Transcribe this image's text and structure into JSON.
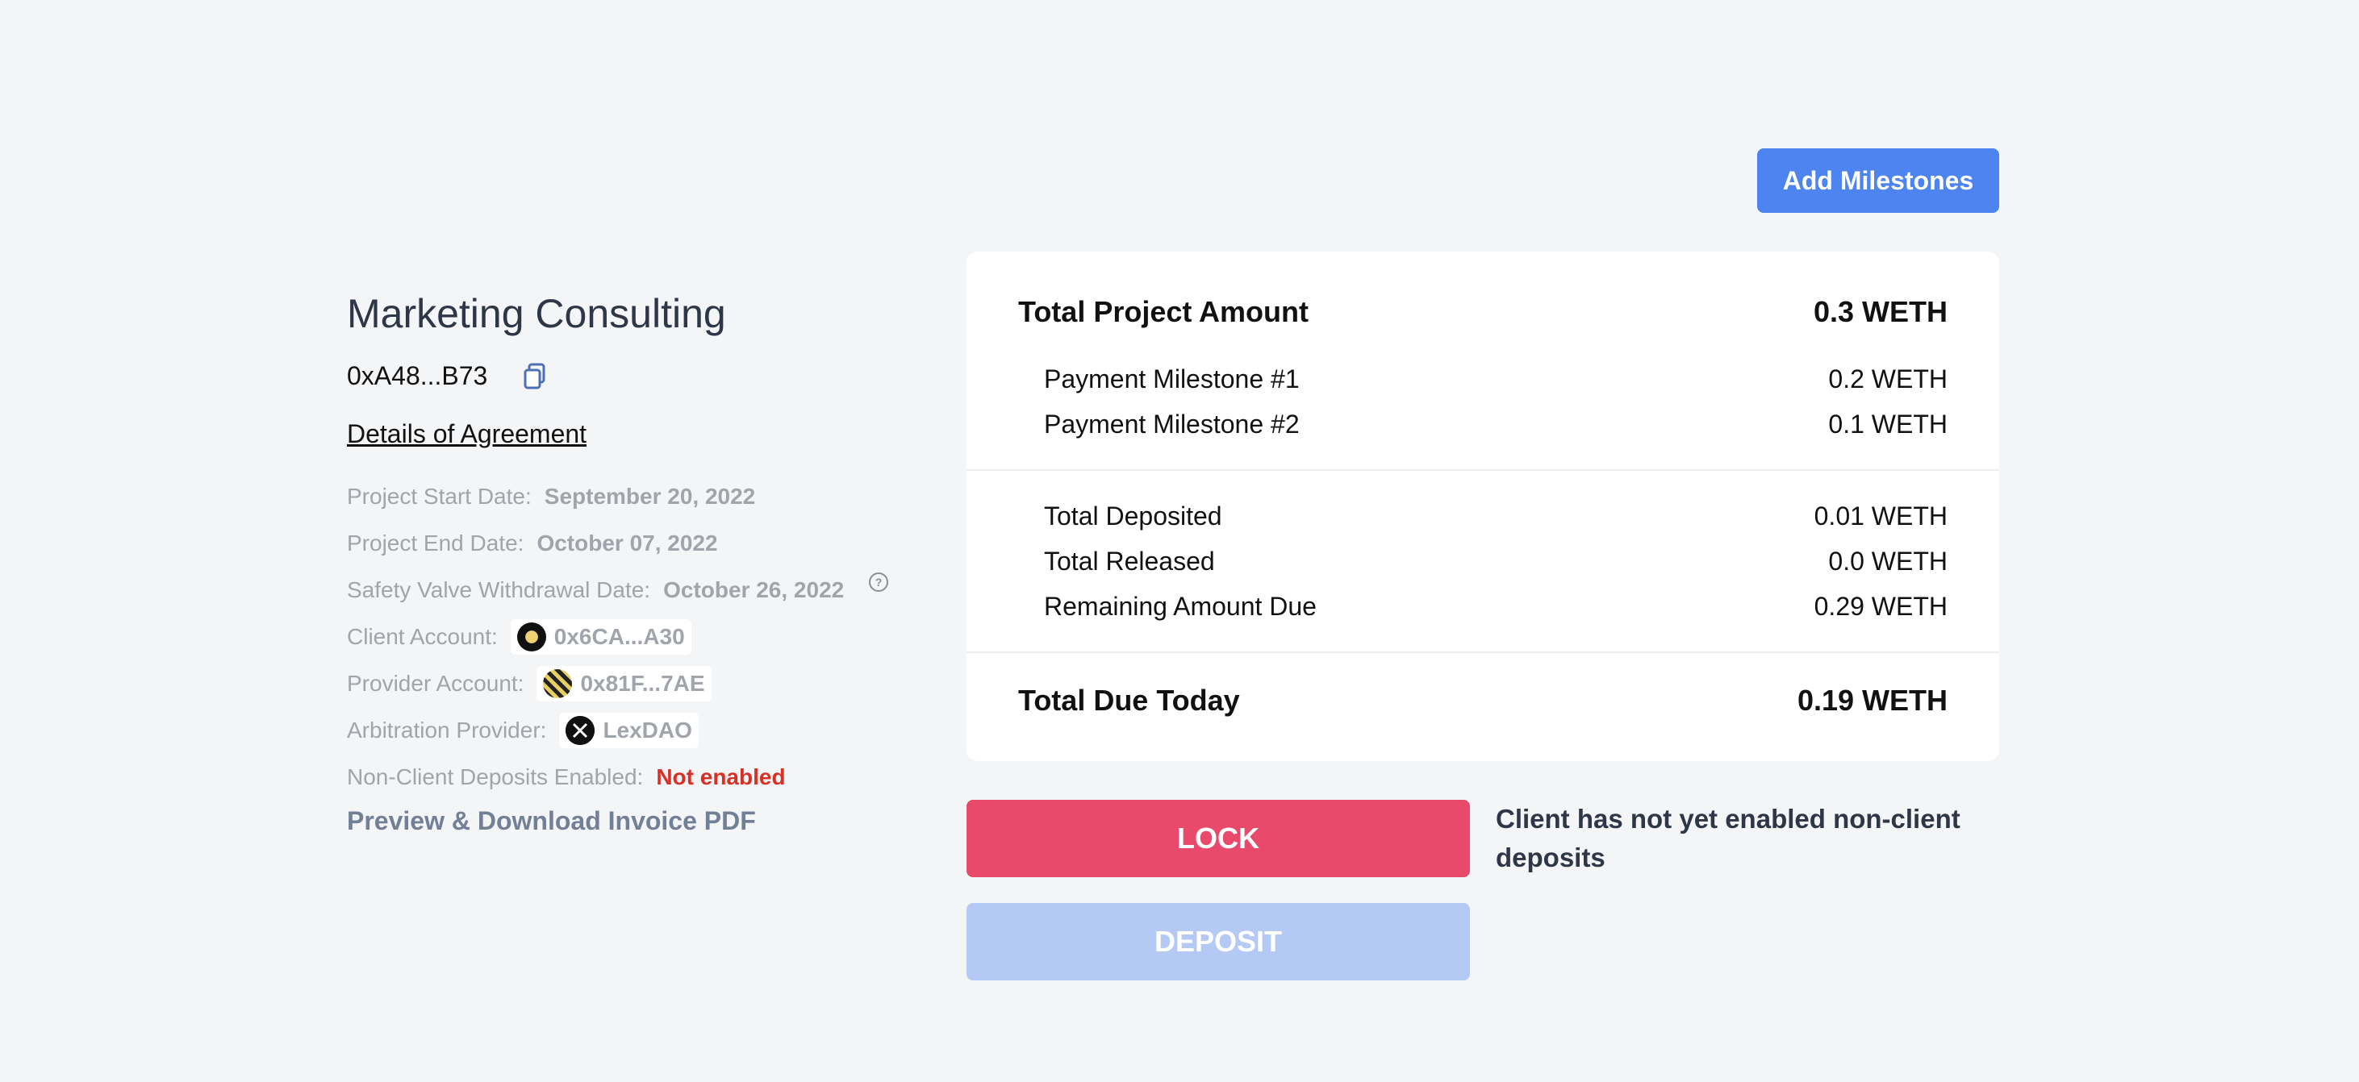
{
  "header": {
    "add_milestones_label": "Add Milestones"
  },
  "invoice": {
    "title": "Marketing Consulting",
    "address": "0xA48...B73",
    "details_link": "Details of Agreement",
    "start_label": "Project Start Date:",
    "start_value": "September 20, 2022",
    "end_label": "Project End Date:",
    "end_value": "October 07, 2022",
    "safety_label": "Safety Valve Withdrawal Date:",
    "safety_value": "October 26, 2022",
    "client_label": "Client Account:",
    "client_value": "0x6CA...A30",
    "provider_label": "Provider Account:",
    "provider_value": "0x81F...7AE",
    "arbitration_label": "Arbitration Provider:",
    "arbitration_value": "LexDAO",
    "non_client_label": "Non-Client Deposits Enabled:",
    "non_client_value": "Not enabled",
    "invoice_pdf_link": "Preview & Download Invoice PDF"
  },
  "summary": {
    "total_project_label": "Total Project Amount",
    "total_project_value": "0.3 WETH",
    "milestones": [
      {
        "label": "Payment Milestone #1",
        "value": "0.2 WETH"
      },
      {
        "label": "Payment Milestone #2",
        "value": "0.1 WETH"
      }
    ],
    "deposited_label": "Total Deposited",
    "deposited_value": "0.01 WETH",
    "released_label": "Total Released",
    "released_value": "0.0 WETH",
    "remaining_label": "Remaining Amount Due",
    "remaining_value": "0.29 WETH",
    "due_today_label": "Total Due Today",
    "due_today_value": "0.19 WETH"
  },
  "actions": {
    "lock_label": "LOCK",
    "deposit_label": "DEPOSIT",
    "notice": "Client has not yet enabled non-client deposits"
  },
  "colors": {
    "primary": "#4d84ef",
    "lock": "#e9496a",
    "deposit_disabled": "#b4c9f3",
    "error": "#d93025"
  }
}
